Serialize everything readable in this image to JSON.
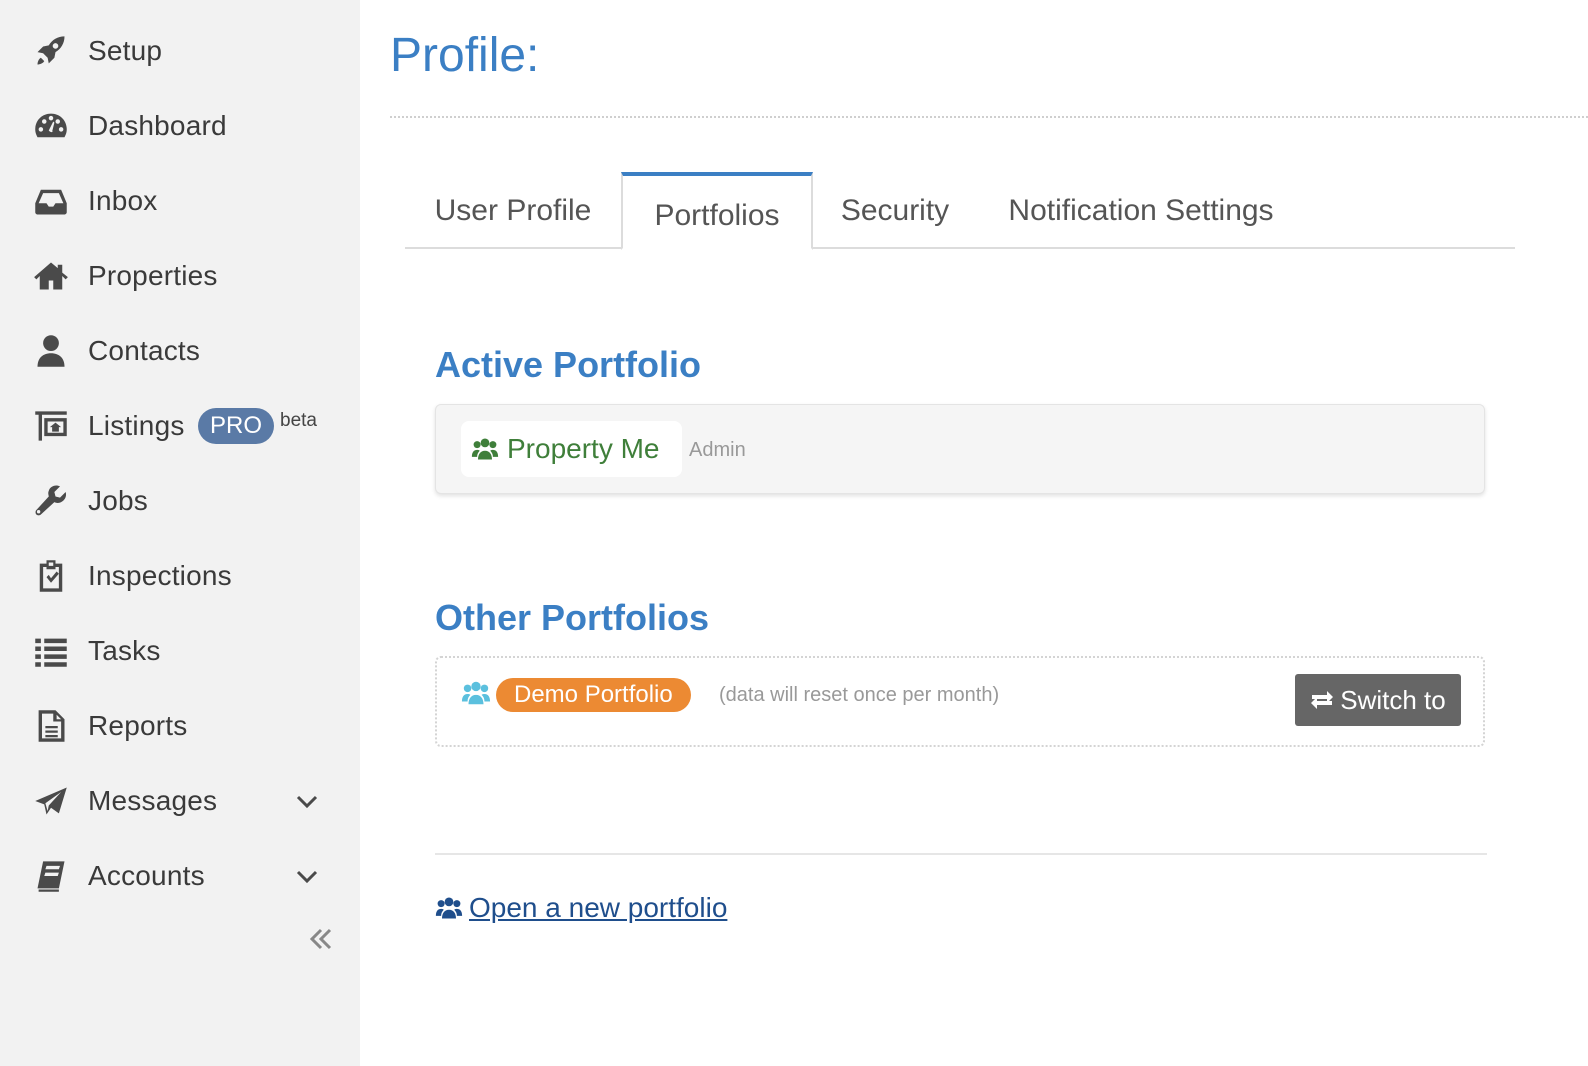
{
  "sidebar": {
    "items": [
      {
        "label": "Setup",
        "icon": "rocket-icon"
      },
      {
        "label": "Dashboard",
        "icon": "palette-icon"
      },
      {
        "label": "Inbox",
        "icon": "inbox-icon"
      },
      {
        "label": "Properties",
        "icon": "home-icon"
      },
      {
        "label": "Contacts",
        "icon": "user-icon"
      },
      {
        "label": "Listings",
        "icon": "listing-sign-icon",
        "badge": "PRO",
        "note": "beta"
      },
      {
        "label": "Jobs",
        "icon": "wrench-icon"
      },
      {
        "label": "Inspections",
        "icon": "clipboard-check-icon"
      },
      {
        "label": "Tasks",
        "icon": "list-icon"
      },
      {
        "label": "Reports",
        "icon": "document-icon"
      },
      {
        "label": "Messages",
        "icon": "paper-plane-icon",
        "expandable": true
      },
      {
        "label": "Accounts",
        "icon": "book-icon",
        "expandable": true
      }
    ],
    "collapse_icon": "double-chevron-left-icon"
  },
  "main": {
    "title": "Profile:",
    "tabs": [
      {
        "label": "User Profile",
        "active": false
      },
      {
        "label": "Portfolios",
        "active": true
      },
      {
        "label": "Security",
        "active": false
      },
      {
        "label": "Notification Settings",
        "active": false
      }
    ],
    "active_portfolio": {
      "heading": "Active Portfolio",
      "name": "Property Me",
      "role": "Admin",
      "icon": "users-icon"
    },
    "other_portfolios": {
      "heading": "Other Portfolios",
      "items": [
        {
          "name": "Demo Portfolio",
          "note": "(data will reset once per month)",
          "button": "Switch to",
          "icon": "users-icon"
        }
      ]
    },
    "new_portfolio_link": "Open a new portfolio"
  },
  "colors": {
    "accent": "#3b7fc4",
    "sidebar_bg": "#f2f2f2",
    "pro_badge": "#5a7aa6",
    "active_portfolio_text": "#3f7f3a",
    "demo_badge": "#ec8a33",
    "switch_button": "#666666",
    "link": "#1f4e8c"
  }
}
